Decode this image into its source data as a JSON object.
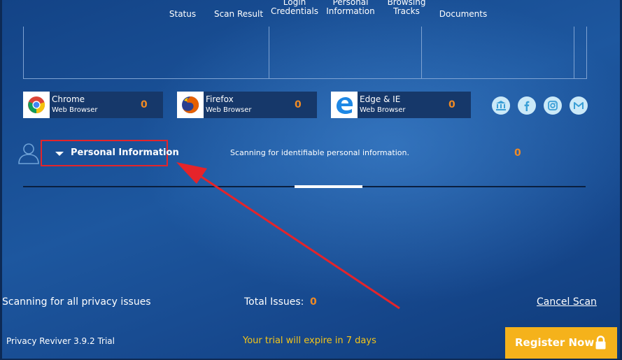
{
  "nav": {
    "tabs": [
      {
        "label": "Status"
      },
      {
        "label": "Scan Result"
      },
      {
        "label": "Login\nCredentials"
      },
      {
        "label": "Personal\nInformation"
      },
      {
        "label": "Browsing\nTracks"
      },
      {
        "label": "Documents"
      }
    ]
  },
  "browsers": [
    {
      "name": "Chrome",
      "subtitle": "Web Browser",
      "count": "0",
      "icon": "chrome-icon"
    },
    {
      "name": "Firefox",
      "subtitle": "Web Browser",
      "count": "0",
      "icon": "firefox-icon"
    },
    {
      "name": "Edge & IE",
      "subtitle": "Web Browser",
      "count": "0",
      "icon": "edge-icon"
    }
  ],
  "social": [
    "bank-icon",
    "facebook-icon",
    "instagram-icon",
    "gmail-icon"
  ],
  "personal_info": {
    "label": "Personal Information",
    "description": "Scanning for identifiable personal information.",
    "count": "0"
  },
  "progress": {
    "scan_indicator": "indeterminate"
  },
  "footer": {
    "status": "Scanning for all privacy issues",
    "total_label": "Total Issues:",
    "total_value": "0",
    "cancel": "Cancel Scan",
    "version": "Privacy Reviver 3.9.2 Trial",
    "trial": "Your trial will expire in 7 days",
    "register": "Register Now"
  },
  "colors": {
    "accent_orange": "#f08a24",
    "trial_yellow": "#f5c518",
    "register_bg": "#f5b21b",
    "highlight_red": "#e5242a",
    "background": "#1b4f96"
  }
}
